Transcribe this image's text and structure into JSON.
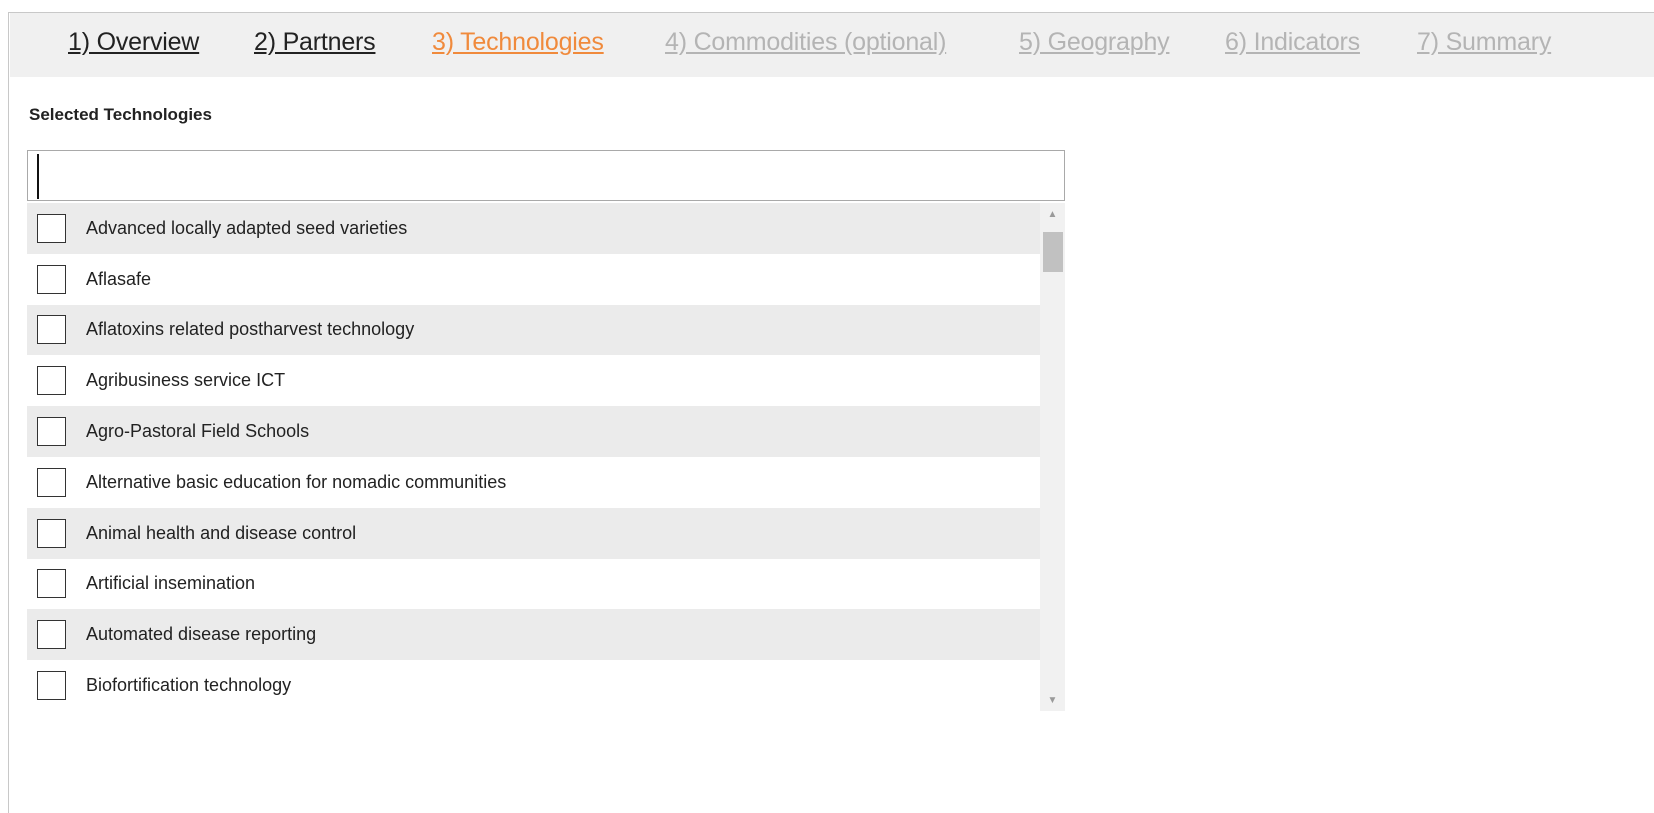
{
  "tabs": [
    {
      "label": "1) Overview",
      "state": "done"
    },
    {
      "label": "2) Partners",
      "state": "done"
    },
    {
      "label": "3) Technologies",
      "state": "active"
    },
    {
      "label": "4) Commodities (optional)",
      "state": "disabled"
    },
    {
      "label": "5) Geography",
      "state": "disabled"
    },
    {
      "label": "6) Indicators",
      "state": "disabled"
    },
    {
      "label": "7) Summary",
      "state": "disabled"
    }
  ],
  "section": {
    "title": "Selected Technologies"
  },
  "search": {
    "value": "",
    "placeholder": ""
  },
  "technologies": [
    {
      "label": "Advanced locally adapted seed varieties",
      "checked": false
    },
    {
      "label": "Aflasafe",
      "checked": false
    },
    {
      "label": "Aflatoxins related postharvest technology",
      "checked": false
    },
    {
      "label": "Agribusiness service ICT",
      "checked": false
    },
    {
      "label": "Agro-Pastoral Field Schools",
      "checked": false
    },
    {
      "label": "Alternative basic education for nomadic communities",
      "checked": false
    },
    {
      "label": "Animal health and disease control",
      "checked": false
    },
    {
      "label": "Artificial insemination",
      "checked": false
    },
    {
      "label": "Automated disease reporting",
      "checked": false
    },
    {
      "label": "Biofortification technology",
      "checked": false
    }
  ],
  "colors": {
    "active_tab": "#f08a3c",
    "done_tab": "#222222",
    "disabled_tab": "#b4b4b4",
    "row_odd": "#ebebeb",
    "row_even": "#ffffff",
    "tabbar_bg": "#f0f0f0"
  },
  "icons": {
    "scroll_up": "triangle-up-icon",
    "scroll_down": "triangle-down-icon"
  }
}
